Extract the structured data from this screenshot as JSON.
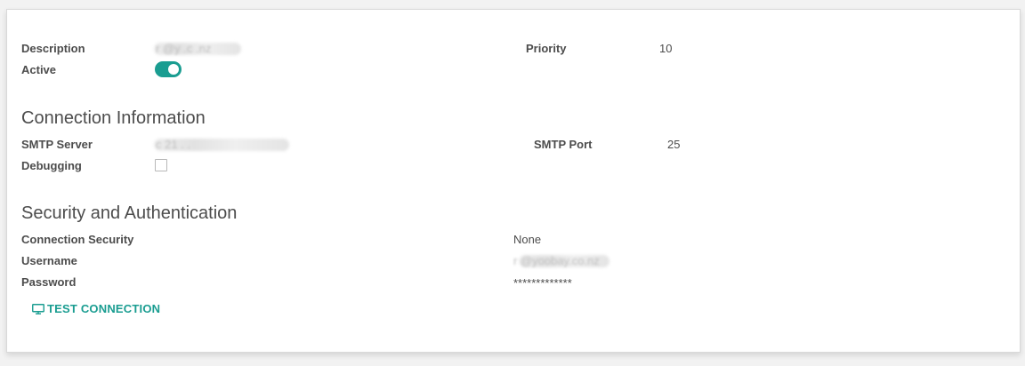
{
  "general": {
    "description_label": "Description",
    "description_value": "r     @y     .c .nz",
    "active_label": "Active",
    "active_on": true,
    "priority_label": "Priority",
    "priority_value": "10"
  },
  "connection": {
    "title": "Connection Information",
    "smtp_server_label": "SMTP Server",
    "smtp_server_value": "c       21   .   .",
    "smtp_port_label": "SMTP Port",
    "smtp_port_value": "25",
    "debugging_label": "Debugging",
    "debugging_checked": false
  },
  "security": {
    "title": "Security and Authentication",
    "connection_security_label": "Connection Security",
    "connection_security_value": "None",
    "username_label": "Username",
    "username_value": "r      @yoobay.co.nz",
    "password_label": "Password",
    "password_value": "*************"
  },
  "actions": {
    "test_connection_label": "TEST CONNECTION",
    "test_connection_icon": "monitor-icon"
  },
  "colors": {
    "accent": "#1a9d91",
    "text": "#4c4c4c",
    "background": "#f2f2f2"
  }
}
